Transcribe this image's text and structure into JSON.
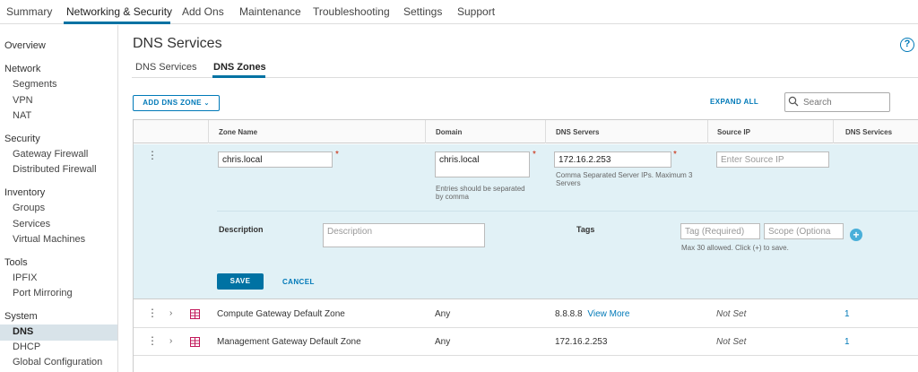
{
  "topnav": {
    "tabs": [
      {
        "label": "Summary"
      },
      {
        "label": "Networking & Security"
      },
      {
        "label": "Add Ons"
      },
      {
        "label": "Maintenance"
      },
      {
        "label": "Troubleshooting"
      },
      {
        "label": "Settings"
      },
      {
        "label": "Support"
      }
    ],
    "active": "Networking & Security"
  },
  "sidebar": {
    "groups": [
      {
        "title": "Overview",
        "items": []
      },
      {
        "title": "Network",
        "items": [
          "Segments",
          "VPN",
          "NAT"
        ]
      },
      {
        "title": "Security",
        "items": [
          "Gateway Firewall",
          "Distributed Firewall"
        ]
      },
      {
        "title": "Inventory",
        "items": [
          "Groups",
          "Services",
          "Virtual Machines"
        ]
      },
      {
        "title": "Tools",
        "items": [
          "IPFIX",
          "Port Mirroring"
        ]
      },
      {
        "title": "System",
        "items": [
          "DNS",
          "DHCP",
          "Global Configuration"
        ]
      }
    ],
    "selected": "DNS"
  },
  "page": {
    "title": "DNS Services",
    "help_icon": "question-circle-icon",
    "subtabs": [
      "DNS Services",
      "DNS Zones"
    ],
    "active_subtab": "DNS Zones",
    "add_button": "ADD DNS ZONE",
    "expand_all": "EXPAND ALL",
    "search_placeholder": "Search"
  },
  "table": {
    "columns": [
      "Zone Name",
      "Domain",
      "DNS Servers",
      "Source IP",
      "DNS Services"
    ],
    "edit_row": {
      "zone_name": "chris.local",
      "domain": "chris.local",
      "domain_hint": "Entries should be separated by comma",
      "dns_servers": "172.16.2.253",
      "dns_servers_hint": "Comma Separated Server IPs. Maximum 3 Servers",
      "source_ip_placeholder": "Enter Source IP",
      "description_label": "Description",
      "description_placeholder": "Description",
      "tags_label": "Tags",
      "tag_placeholder": "Tag (Required)",
      "scope_placeholder": "Scope (Optiona",
      "tags_hint": "Max 30 allowed. Click (+) to save.",
      "save": "SAVE",
      "cancel": "CANCEL"
    },
    "rows": [
      {
        "zone_name": "Compute Gateway Default Zone",
        "domain": "Any",
        "dns_servers": "8.8.8.8",
        "view_more": "View More",
        "source_ip": "Not Set",
        "dns_services": "1"
      },
      {
        "zone_name": "Management Gateway Default Zone",
        "domain": "Any",
        "dns_servers": "172.16.2.253",
        "view_more": "",
        "source_ip": "Not Set",
        "dns_services": "1"
      }
    ]
  },
  "colors": {
    "accent": "#0079b8",
    "edit_bg": "#e1f1f6",
    "required": "#c92100"
  }
}
